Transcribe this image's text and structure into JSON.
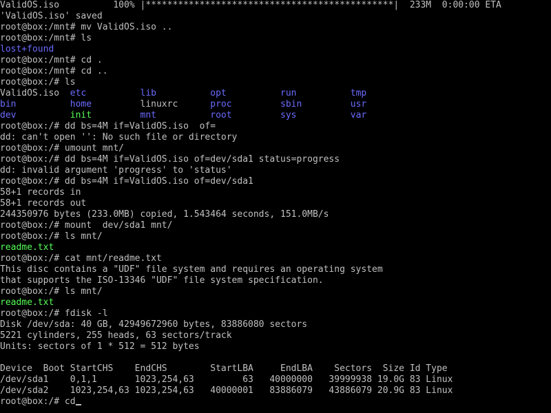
{
  "theme": {
    "background": "#000000",
    "foreground": "#c0c0c0",
    "dir_color": "#6b6bff",
    "exec_color": "#55ff55"
  },
  "lines": [
    [
      {
        "t": "ValidOS.iso          100% |**********************************************|  233M  0:00:00 ETA",
        "c": "default"
      }
    ],
    [
      {
        "t": "'ValidOS.iso' saved",
        "c": "default"
      }
    ],
    [
      {
        "t": "root@box:/mnt# mv ValidOS.iso ..",
        "c": "default"
      }
    ],
    [
      {
        "t": "root@box:/mnt# ls",
        "c": "default"
      }
    ],
    [
      {
        "t": "lost+found",
        "c": "blue"
      }
    ],
    [
      {
        "t": "root@box:/mnt# cd .",
        "c": "default"
      }
    ],
    [
      {
        "t": "root@box:/mnt# cd ..",
        "c": "default"
      }
    ],
    [
      {
        "t": "root@box:/# ls",
        "c": "default"
      }
    ],
    [
      {
        "t": "ValidOS.iso  ",
        "c": "default"
      },
      {
        "t": "etc          ",
        "c": "blue"
      },
      {
        "t": "lib          ",
        "c": "blue"
      },
      {
        "t": "opt          ",
        "c": "blue"
      },
      {
        "t": "run          ",
        "c": "blue"
      },
      {
        "t": "tmp",
        "c": "blue"
      }
    ],
    [
      {
        "t": "bin          ",
        "c": "blue"
      },
      {
        "t": "home         ",
        "c": "blue"
      },
      {
        "t": "linuxrc      ",
        "c": "default"
      },
      {
        "t": "proc         ",
        "c": "blue"
      },
      {
        "t": "sbin         ",
        "c": "blue"
      },
      {
        "t": "usr",
        "c": "blue"
      }
    ],
    [
      {
        "t": "dev          ",
        "c": "blue"
      },
      {
        "t": "init         ",
        "c": "green"
      },
      {
        "t": "mnt          ",
        "c": "blue"
      },
      {
        "t": "root         ",
        "c": "blue"
      },
      {
        "t": "sys          ",
        "c": "blue"
      },
      {
        "t": "var",
        "c": "blue"
      }
    ],
    [
      {
        "t": "root@box:/# dd bs=4M if=ValidOS.iso  of=",
        "c": "default"
      }
    ],
    [
      {
        "t": "dd: can't open '': No such file or directory",
        "c": "default"
      }
    ],
    [
      {
        "t": "root@box:/# umount mnt/",
        "c": "default"
      }
    ],
    [
      {
        "t": "root@box:/# dd bs=4M if=ValidOS.iso of=dev/sda1 status=progress",
        "c": "default"
      }
    ],
    [
      {
        "t": "dd: invalid argument 'progress' to 'status'",
        "c": "default"
      }
    ],
    [
      {
        "t": "root@box:/# dd bs=4M if=ValidOS.iso of=dev/sda1",
        "c": "default"
      }
    ],
    [
      {
        "t": "58+1 records in",
        "c": "default"
      }
    ],
    [
      {
        "t": "58+1 records out",
        "c": "default"
      }
    ],
    [
      {
        "t": "244350976 bytes (233.0MB) copied, 1.543464 seconds, 151.0MB/s",
        "c": "default"
      }
    ],
    [
      {
        "t": "root@box:/# mount  dev/sda1 mnt/",
        "c": "default"
      }
    ],
    [
      {
        "t": "root@box:/# ls mnt/",
        "c": "default"
      }
    ],
    [
      {
        "t": "readme.txt",
        "c": "green"
      }
    ],
    [
      {
        "t": "root@box:/# cat mnt/readme.txt",
        "c": "default"
      }
    ],
    [
      {
        "t": "This disc contains a \"UDF\" file system and requires an operating system",
        "c": "default"
      }
    ],
    [
      {
        "t": "that supports the ISO-13346 \"UDF\" file system specification.",
        "c": "default"
      }
    ],
    [
      {
        "t": "root@box:/# ls mnt/",
        "c": "default"
      }
    ],
    [
      {
        "t": "readme.txt",
        "c": "green"
      }
    ],
    [
      {
        "t": "root@box:/# fdisk -l",
        "c": "default"
      }
    ],
    [
      {
        "t": "Disk /dev/sda: 40 GB, 42949672960 bytes, 83886080 sectors",
        "c": "default"
      }
    ],
    [
      {
        "t": "5221 cylinders, 255 heads, 63 sectors/track",
        "c": "default"
      }
    ],
    [
      {
        "t": "Units: sectors of 1 * 512 = 512 bytes",
        "c": "default"
      }
    ],
    [
      {
        "t": "",
        "c": "default"
      }
    ],
    [
      {
        "t": "Device  Boot StartCHS    EndCHS        StartLBA     EndLBA    Sectors  Size Id Type",
        "c": "default"
      }
    ],
    [
      {
        "t": "/dev/sda1    0,1,1       1023,254,63         63   40000000   39999938 19.0G 83 Linux",
        "c": "default"
      }
    ],
    [
      {
        "t": "/dev/sda2    1023,254,63 1023,254,63   40000001   83886079   43886079 20.9G 83 Linux",
        "c": "default"
      }
    ],
    [
      {
        "t": "root@box:/# cd",
        "c": "default"
      }
    ]
  ]
}
